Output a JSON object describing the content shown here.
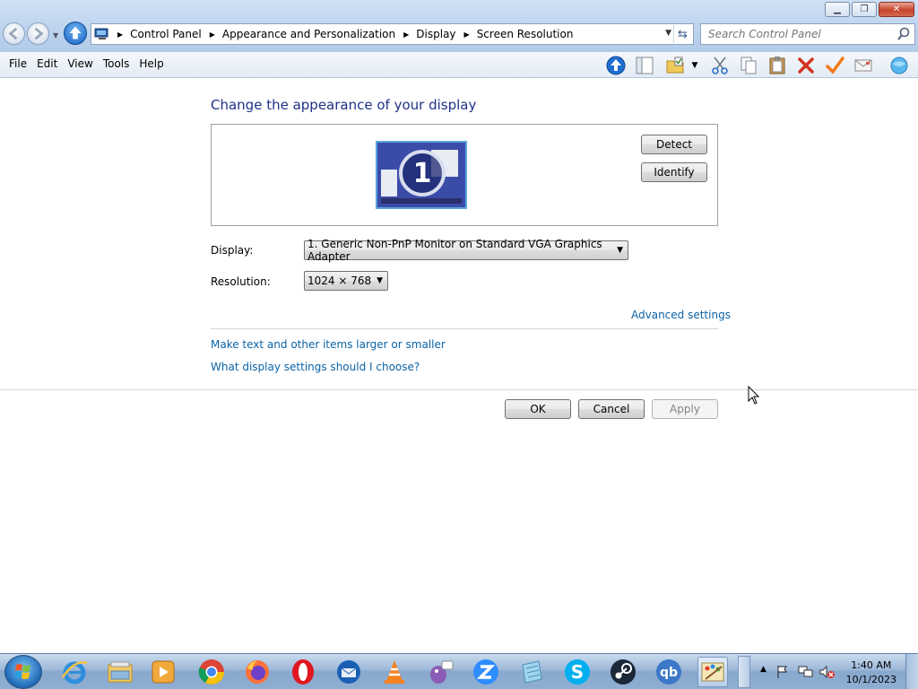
{
  "window": {
    "controls": {
      "minimize": "▁",
      "restore": "❐",
      "close": "✕"
    }
  },
  "address": {
    "breadcrumbs": [
      "Control Panel",
      "Appearance and Personalization",
      "Display",
      "Screen Resolution"
    ]
  },
  "search": {
    "placeholder": "Search Control Panel"
  },
  "menu": {
    "items": [
      "File",
      "Edit",
      "View",
      "Tools",
      "Help"
    ]
  },
  "toolbar_icons": [
    "up-icon",
    "pane-icon",
    "folder-options-icon",
    "cut-icon",
    "copy-icon",
    "paste-icon",
    "delete-icon",
    "check-icon",
    "email-icon",
    "web-icon"
  ],
  "main": {
    "heading": "Change the appearance of your display",
    "monitor_number": "1",
    "detect_label": "Detect",
    "identify_label": "Identify",
    "display_label": "Display:",
    "display_value": "1. Generic Non-PnP Monitor on Standard VGA Graphics Adapter",
    "resolution_label": "Resolution:",
    "resolution_value": "1024 × 768",
    "advanced_link": "Advanced settings",
    "link_text_size": "Make text and other items larger or smaller",
    "link_display_help": "What display settings should I choose?",
    "ok_label": "OK",
    "cancel_label": "Cancel",
    "apply_label": "Apply"
  },
  "taskbar": {
    "apps": [
      "internet-explorer-icon",
      "file-explorer-icon",
      "media-player-icon",
      "chrome-icon",
      "firefox-icon",
      "opera-icon",
      "thunderbird-icon",
      "vlc-icon",
      "pidgin-icon",
      "zoom-icon",
      "notepad-icon",
      "skype-icon",
      "steam-icon",
      "qbittorrent-icon",
      "paint-icon"
    ],
    "time": "1:40 AM",
    "date": "10/1/2023"
  },
  "colors": {
    "heading": "#1e3287",
    "link": "#0b63a6",
    "chrome": "#bcd3ee"
  }
}
